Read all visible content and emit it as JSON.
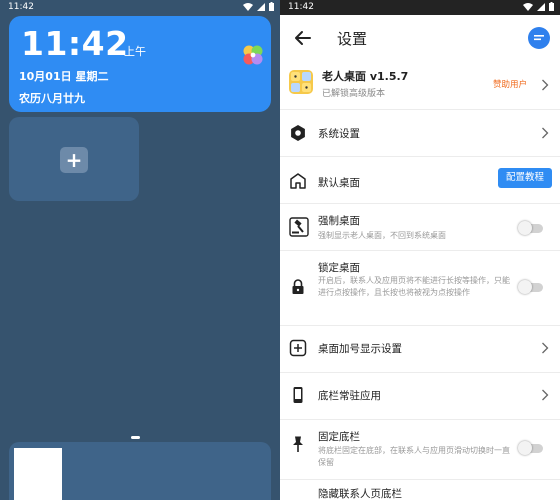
{
  "left": {
    "status": {
      "time": "11:42"
    },
    "clock": {
      "time": "11:42",
      "ampm": "上午",
      "date": "10月01日  星期二",
      "lunar": "农历八月廿九"
    },
    "add_label": "+"
  },
  "right": {
    "status": {
      "time": "11:42"
    },
    "title": "设置",
    "app": {
      "name": "老人桌面 v1.5.7",
      "subtitle": "已解锁高级版本",
      "vip": "赞助用户"
    },
    "items": [
      {
        "label": "系统设置"
      },
      {
        "label": "默认桌面",
        "button": "配置教程"
      },
      {
        "label": "强制桌面",
        "sub": "强制显示老人桌面，不回到系统桌面"
      },
      {
        "label": "锁定桌面",
        "sub": "开启后，联系人及应用页将不能进行长按等操作，只能进行点按操作，且长按也将被视为点按操作"
      },
      {
        "label": "桌面加号显示设置"
      },
      {
        "label": "底栏常驻应用"
      },
      {
        "label": "固定底栏",
        "sub": "将底栏固定在底部，在联系人与应用页滑动切换时一直保留"
      },
      {
        "label": "隐藏联系人页底栏"
      }
    ]
  },
  "colors": {
    "accent": "#2f8cf3",
    "vip": "#f06a1c",
    "launcher_bg": "#36536e"
  }
}
